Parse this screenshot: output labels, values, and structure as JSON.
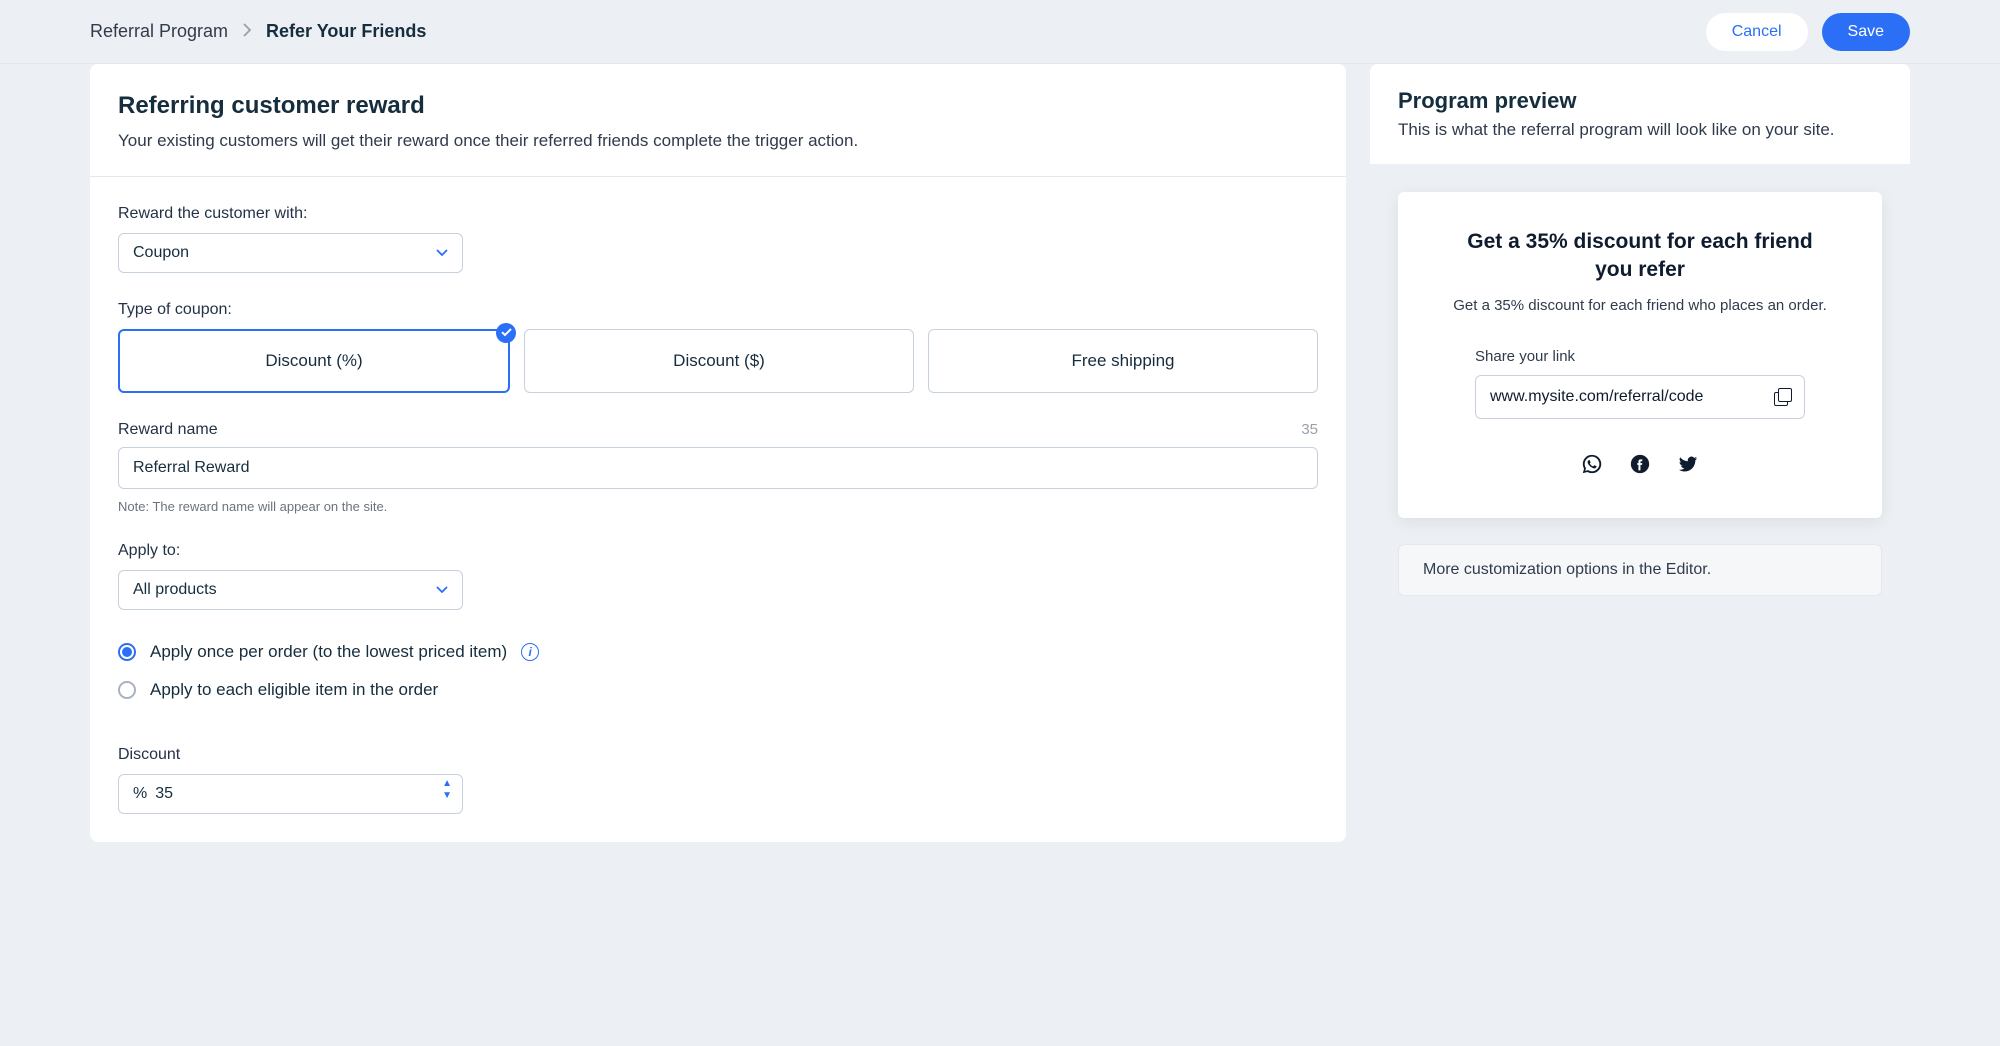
{
  "topbar": {
    "breadcrumb_root": "Referral Program",
    "breadcrumb_current": "Refer Your Friends",
    "cancel_label": "Cancel",
    "save_label": "Save"
  },
  "main": {
    "title": "Referring customer reward",
    "description": "Your existing customers will get their reward once their referred friends complete the trigger action.",
    "reward_with_label": "Reward the customer with:",
    "reward_with_value": "Coupon",
    "type_of_coupon_label": "Type of coupon:",
    "coupon_types": {
      "percent": "Discount (%)",
      "amount": "Discount ($)",
      "free_shipping": "Free shipping"
    },
    "reward_name_label": "Reward name",
    "reward_name_counter": "35",
    "reward_name_value": "Referral Reward",
    "reward_name_note": "Note: The reward name will appear on the site.",
    "apply_to_label": "Apply to:",
    "apply_to_value": "All products",
    "radios": {
      "once_per_order": "Apply once per order (to the lowest priced item)",
      "each_item": "Apply to each eligible item in the order"
    },
    "discount_label": "Discount",
    "discount_unit": "%",
    "discount_value": "35"
  },
  "preview": {
    "title": "Program preview",
    "description": "This is what the referral program will look like on your site.",
    "card_title": "Get a 35% discount for each friend you refer",
    "card_sub": "Get a 35% discount for each friend who places an order.",
    "share_label": "Share your link",
    "share_url": "www.mysite.com/referral/code",
    "editor_note": "More customization options in the Editor."
  }
}
